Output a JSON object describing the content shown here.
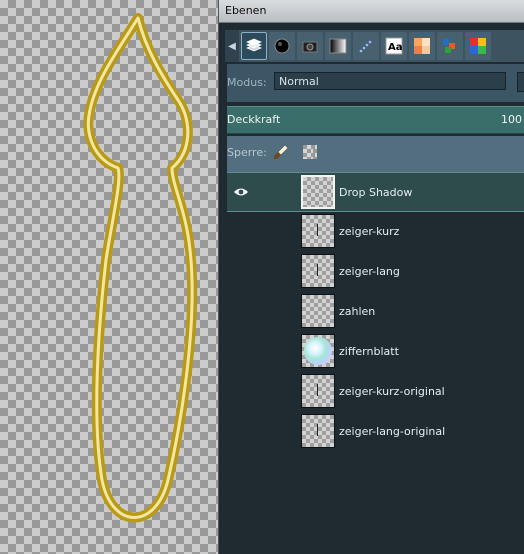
{
  "dock": {
    "title": "Ebenen"
  },
  "tabs": [
    {
      "name": "layers-tab-icon",
      "active": true
    },
    {
      "name": "channels-tab-icon"
    },
    {
      "name": "paths-tab-icon"
    },
    {
      "name": "gradient-tab-icon"
    },
    {
      "name": "dynamics-tab-icon"
    },
    {
      "name": "fonts-tab-icon"
    },
    {
      "name": "palettes-tab-icon"
    },
    {
      "name": "patterns-tab-icon"
    },
    {
      "name": "colormap-tab-icon"
    }
  ],
  "mode": {
    "label": "Modus:",
    "value": "Normal"
  },
  "opacity": {
    "label": "Deckkraft",
    "value": "100"
  },
  "lock": {
    "label": "Sperre:"
  },
  "layers": [
    {
      "name": "Drop Shadow",
      "visible": true,
      "selected": true,
      "thumb": "empty"
    },
    {
      "name": "zeiger-kurz",
      "thumb": "needle"
    },
    {
      "name": "zeiger-lang",
      "thumb": "needle"
    },
    {
      "name": "zahlen",
      "thumb": "empty"
    },
    {
      "name": "ziffernblatt",
      "thumb": "dial"
    },
    {
      "name": "zeiger-kurz-original",
      "thumb": "needle"
    },
    {
      "name": "zeiger-lang-original",
      "thumb": "needle"
    }
  ],
  "colors": {
    "outline": "#d8c230",
    "panel": "#1f2a31",
    "selected": "#2e4c4c",
    "opacity_bar": "#3a6e6a"
  }
}
